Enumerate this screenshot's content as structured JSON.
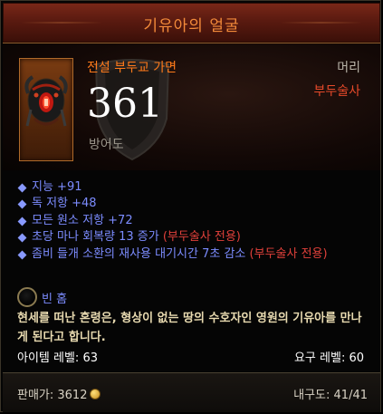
{
  "item": {
    "name": "기유아의 얼굴",
    "rarity_type": "전설 부두교 가면",
    "slot": "머리",
    "class_requirement": "부두술사",
    "armor_value": "361",
    "armor_label": "방어도"
  },
  "stats": [
    {
      "text": "지능 +91"
    },
    {
      "text": "독 저항 +48"
    },
    {
      "text": "모든 원소 저항 +72"
    },
    {
      "text": "초당 마나 회복량 13 증가 ",
      "tag": "(부두술사 전용)"
    },
    {
      "text": "좀비 들개 소환의 재사용 대기시간 7초 감소 ",
      "tag": "(부두술사 전용)"
    }
  ],
  "socket": {
    "label": "빈 홈"
  },
  "flavor_text": "현세를 떠난 혼령은, 형상이 없는 땅의 수호자인 영원의 기유아를 만나게 된다고 합니다.",
  "levels": {
    "item_level": "아이템 레벨: 63",
    "required_level": "요구 레벨: 60"
  },
  "footer": {
    "price": "판매가: 3612",
    "durability": "내구도: 41/41"
  },
  "colors": {
    "legendary": "#ff7a1a",
    "magic": "#7c8cff",
    "class_tag": "#e0403a",
    "title": "#f28a3a",
    "flavor": "#e8dab0"
  },
  "icons": [
    "voodoo-mask-icon",
    "shield-watermark-icon",
    "diamond-bullet-icon",
    "empty-socket-icon",
    "gold-coin-icon"
  ]
}
